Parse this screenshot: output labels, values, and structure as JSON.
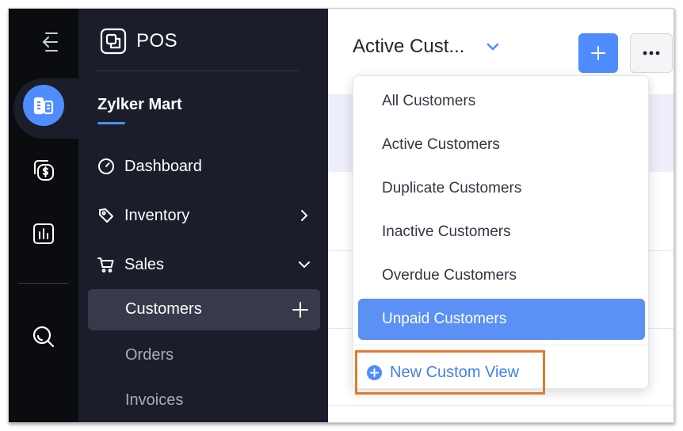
{
  "app": {
    "title": "POS"
  },
  "rail": {
    "items": [
      {
        "name": "collapse-sidebar",
        "icon": "collapse-left-arrow-icon"
      },
      {
        "name": "store",
        "icon": "building-icon",
        "active": true
      },
      {
        "name": "payments",
        "icon": "dollar-coins-icon"
      },
      {
        "name": "reports",
        "icon": "bar-chart-icon"
      },
      {
        "name": "search",
        "icon": "search-icon"
      }
    ]
  },
  "sidebar": {
    "org_name": "Zylker Mart",
    "nav": [
      {
        "label": "Dashboard",
        "icon": "gauge-icon"
      },
      {
        "label": "Inventory",
        "icon": "tag-icon",
        "chevron": "chevron-right-icon"
      },
      {
        "label": "Sales",
        "icon": "cart-icon",
        "chevron": "chevron-down-icon"
      }
    ],
    "sales_items": [
      {
        "label": "Customers",
        "active": true
      },
      {
        "label": "Orders"
      },
      {
        "label": "Invoices"
      }
    ]
  },
  "main": {
    "view_title": "Active Cust...",
    "new_button_icon": "plus-icon",
    "more_button_icon": "more-horizontal-icon"
  },
  "dropdown": {
    "items": [
      "All Customers",
      "Active Customers",
      "Duplicate Customers",
      "Inactive Customers",
      "Overdue Customers",
      "Unpaid Customers"
    ],
    "selected": "Unpaid Customers",
    "new_custom_view": "New Custom View"
  },
  "colors": {
    "accent": "#4f8dff",
    "selected_row": "#5b91f5",
    "highlight_outline": "#e07b2c",
    "sidebar_bg": "#1b1e2a",
    "rail_bg": "#0b0c10"
  }
}
